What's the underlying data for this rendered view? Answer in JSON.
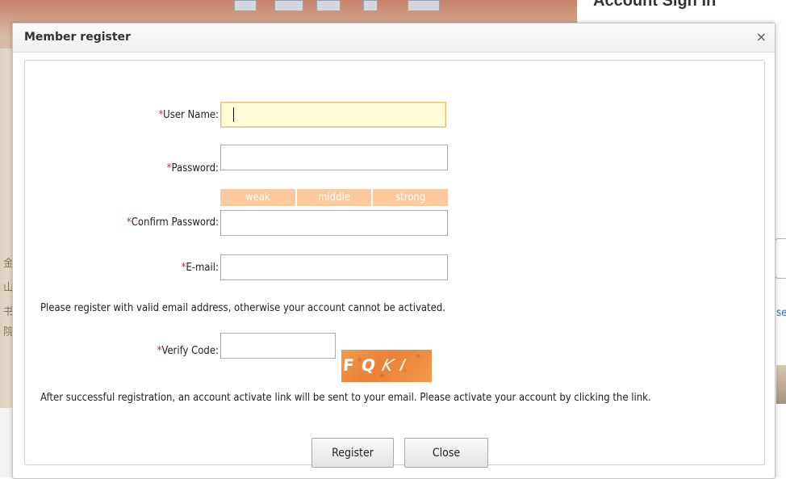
{
  "background": {
    "heading": "Account Sign In",
    "link_fragment": "se",
    "side_chars": [
      "金",
      "山",
      "书",
      "院"
    ]
  },
  "dialog": {
    "title": "Member register",
    "close_glyph": "×"
  },
  "form": {
    "required_marker": "*",
    "username": {
      "label": "User Name:",
      "value": ""
    },
    "password": {
      "label": "Password:",
      "value": ""
    },
    "strength": {
      "weak": "weak",
      "middle": "middle",
      "strong": "strong"
    },
    "confirm": {
      "label": "Confirm Password:",
      "value": ""
    },
    "email": {
      "label": "E-mail:",
      "value": ""
    },
    "email_note": "Please register with valid email address, otherwise your account cannot be activated.",
    "verify": {
      "label": "Verify Code:",
      "value": ""
    },
    "captcha": {
      "c1": "F",
      "c2": "Q",
      "c3": "K",
      "c4": "I"
    },
    "activation_note": "After successful registration, an account activate link will be sent to your email. Please activate your account by clicking the link."
  },
  "buttons": {
    "register": "Register",
    "close": "Close"
  },
  "colors": {
    "required": "#e02020",
    "strength_bar": "#fbc99c",
    "focused_input": "#fffdd8",
    "captcha": "#f08a3e"
  }
}
